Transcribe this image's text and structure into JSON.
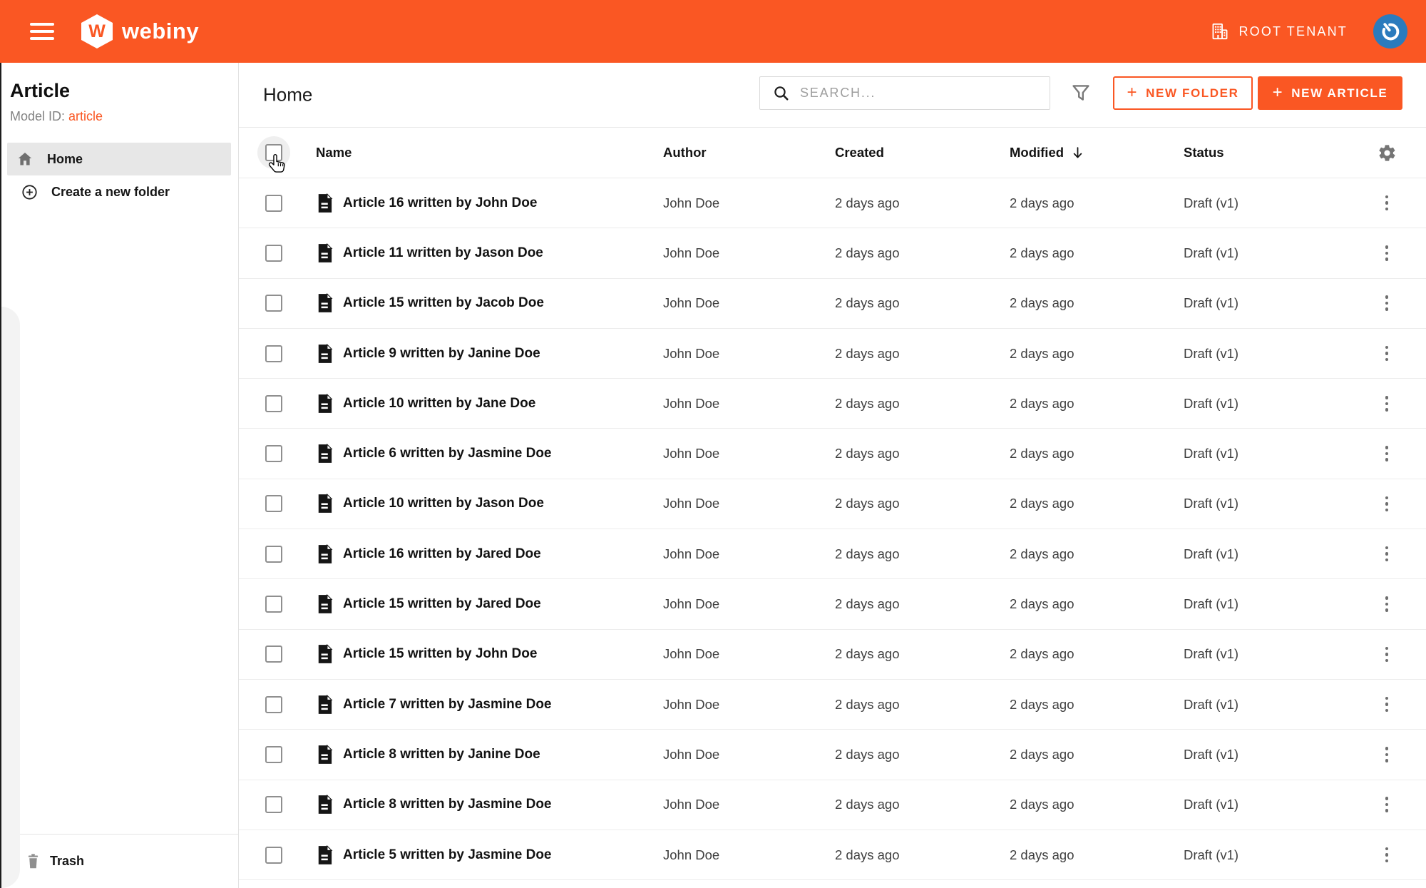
{
  "colors": {
    "accent": "#fa5723",
    "avatar_blue": "#2b7bbd"
  },
  "topbar": {
    "logo_letter": "W",
    "brand": "webiny",
    "tenant_label": "ROOT TENANT"
  },
  "sidebar": {
    "title": "Article",
    "model_id_label": "Model ID:",
    "model_id_value": "article",
    "home_label": "Home",
    "create_folder_label": "Create a new folder",
    "trash_label": "Trash"
  },
  "toolbar": {
    "page_title": "Home",
    "search_placeholder": "SEARCH...",
    "plus": "+",
    "new_folder_label": "NEW FOLDER",
    "new_article_label": "NEW ARTICLE"
  },
  "table": {
    "headers": {
      "name": "Name",
      "author": "Author",
      "created": "Created",
      "modified": "Modified",
      "status": "Status"
    },
    "sort_column": "Modified",
    "sort_direction": "descending",
    "rows": [
      {
        "name": "Article 16 written by John Doe",
        "author": "John Doe",
        "created": "2 days ago",
        "modified": "2 days ago",
        "status": "Draft (v1)"
      },
      {
        "name": "Article 11 written by Jason Doe",
        "author": "John Doe",
        "created": "2 days ago",
        "modified": "2 days ago",
        "status": "Draft (v1)"
      },
      {
        "name": "Article 15 written by Jacob Doe",
        "author": "John Doe",
        "created": "2 days ago",
        "modified": "2 days ago",
        "status": "Draft (v1)"
      },
      {
        "name": "Article 9 written by Janine Doe",
        "author": "John Doe",
        "created": "2 days ago",
        "modified": "2 days ago",
        "status": "Draft (v1)"
      },
      {
        "name": "Article 10 written by Jane Doe",
        "author": "John Doe",
        "created": "2 days ago",
        "modified": "2 days ago",
        "status": "Draft (v1)"
      },
      {
        "name": "Article 6 written by Jasmine Doe",
        "author": "John Doe",
        "created": "2 days ago",
        "modified": "2 days ago",
        "status": "Draft (v1)"
      },
      {
        "name": "Article 10 written by Jason Doe",
        "author": "John Doe",
        "created": "2 days ago",
        "modified": "2 days ago",
        "status": "Draft (v1)"
      },
      {
        "name": "Article 16 written by Jared Doe",
        "author": "John Doe",
        "created": "2 days ago",
        "modified": "2 days ago",
        "status": "Draft (v1)"
      },
      {
        "name": "Article 15 written by Jared Doe",
        "author": "John Doe",
        "created": "2 days ago",
        "modified": "2 days ago",
        "status": "Draft (v1)"
      },
      {
        "name": "Article 15 written by John Doe",
        "author": "John Doe",
        "created": "2 days ago",
        "modified": "2 days ago",
        "status": "Draft (v1)"
      },
      {
        "name": "Article 7 written by Jasmine Doe",
        "author": "John Doe",
        "created": "2 days ago",
        "modified": "2 days ago",
        "status": "Draft (v1)"
      },
      {
        "name": "Article 8 written by Janine Doe",
        "author": "John Doe",
        "created": "2 days ago",
        "modified": "2 days ago",
        "status": "Draft (v1)"
      },
      {
        "name": "Article 8 written by Jasmine Doe",
        "author": "John Doe",
        "created": "2 days ago",
        "modified": "2 days ago",
        "status": "Draft (v1)"
      },
      {
        "name": "Article 5 written by Jasmine Doe",
        "author": "John Doe",
        "created": "2 days ago",
        "modified": "2 days ago",
        "status": "Draft (v1)"
      }
    ]
  }
}
